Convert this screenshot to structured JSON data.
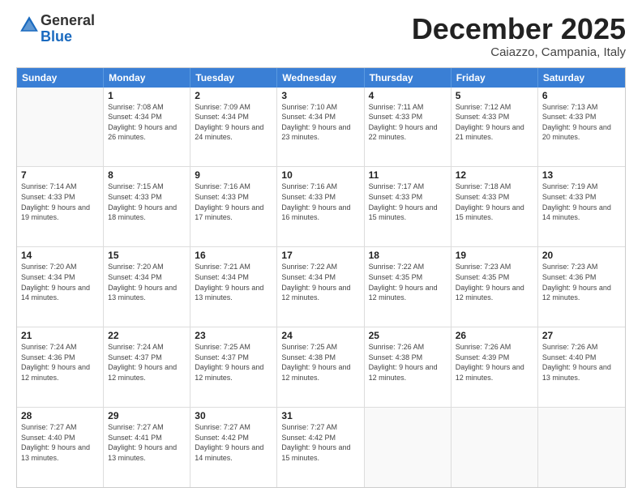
{
  "logo": {
    "line1": "General",
    "line2": "Blue"
  },
  "title": "December 2025",
  "location": "Caiazzo, Campania, Italy",
  "headers": [
    "Sunday",
    "Monday",
    "Tuesday",
    "Wednesday",
    "Thursday",
    "Friday",
    "Saturday"
  ],
  "rows": [
    [
      {
        "day": "",
        "sunrise": "",
        "sunset": "",
        "daylight": ""
      },
      {
        "day": "1",
        "sunrise": "Sunrise: 7:08 AM",
        "sunset": "Sunset: 4:34 PM",
        "daylight": "Daylight: 9 hours and 26 minutes."
      },
      {
        "day": "2",
        "sunrise": "Sunrise: 7:09 AM",
        "sunset": "Sunset: 4:34 PM",
        "daylight": "Daylight: 9 hours and 24 minutes."
      },
      {
        "day": "3",
        "sunrise": "Sunrise: 7:10 AM",
        "sunset": "Sunset: 4:34 PM",
        "daylight": "Daylight: 9 hours and 23 minutes."
      },
      {
        "day": "4",
        "sunrise": "Sunrise: 7:11 AM",
        "sunset": "Sunset: 4:33 PM",
        "daylight": "Daylight: 9 hours and 22 minutes."
      },
      {
        "day": "5",
        "sunrise": "Sunrise: 7:12 AM",
        "sunset": "Sunset: 4:33 PM",
        "daylight": "Daylight: 9 hours and 21 minutes."
      },
      {
        "day": "6",
        "sunrise": "Sunrise: 7:13 AM",
        "sunset": "Sunset: 4:33 PM",
        "daylight": "Daylight: 9 hours and 20 minutes."
      }
    ],
    [
      {
        "day": "7",
        "sunrise": "Sunrise: 7:14 AM",
        "sunset": "Sunset: 4:33 PM",
        "daylight": "Daylight: 9 hours and 19 minutes."
      },
      {
        "day": "8",
        "sunrise": "Sunrise: 7:15 AM",
        "sunset": "Sunset: 4:33 PM",
        "daylight": "Daylight: 9 hours and 18 minutes."
      },
      {
        "day": "9",
        "sunrise": "Sunrise: 7:16 AM",
        "sunset": "Sunset: 4:33 PM",
        "daylight": "Daylight: 9 hours and 17 minutes."
      },
      {
        "day": "10",
        "sunrise": "Sunrise: 7:16 AM",
        "sunset": "Sunset: 4:33 PM",
        "daylight": "Daylight: 9 hours and 16 minutes."
      },
      {
        "day": "11",
        "sunrise": "Sunrise: 7:17 AM",
        "sunset": "Sunset: 4:33 PM",
        "daylight": "Daylight: 9 hours and 15 minutes."
      },
      {
        "day": "12",
        "sunrise": "Sunrise: 7:18 AM",
        "sunset": "Sunset: 4:33 PM",
        "daylight": "Daylight: 9 hours and 15 minutes."
      },
      {
        "day": "13",
        "sunrise": "Sunrise: 7:19 AM",
        "sunset": "Sunset: 4:33 PM",
        "daylight": "Daylight: 9 hours and 14 minutes."
      }
    ],
    [
      {
        "day": "14",
        "sunrise": "Sunrise: 7:20 AM",
        "sunset": "Sunset: 4:34 PM",
        "daylight": "Daylight: 9 hours and 14 minutes."
      },
      {
        "day": "15",
        "sunrise": "Sunrise: 7:20 AM",
        "sunset": "Sunset: 4:34 PM",
        "daylight": "Daylight: 9 hours and 13 minutes."
      },
      {
        "day": "16",
        "sunrise": "Sunrise: 7:21 AM",
        "sunset": "Sunset: 4:34 PM",
        "daylight": "Daylight: 9 hours and 13 minutes."
      },
      {
        "day": "17",
        "sunrise": "Sunrise: 7:22 AM",
        "sunset": "Sunset: 4:34 PM",
        "daylight": "Daylight: 9 hours and 12 minutes."
      },
      {
        "day": "18",
        "sunrise": "Sunrise: 7:22 AM",
        "sunset": "Sunset: 4:35 PM",
        "daylight": "Daylight: 9 hours and 12 minutes."
      },
      {
        "day": "19",
        "sunrise": "Sunrise: 7:23 AM",
        "sunset": "Sunset: 4:35 PM",
        "daylight": "Daylight: 9 hours and 12 minutes."
      },
      {
        "day": "20",
        "sunrise": "Sunrise: 7:23 AM",
        "sunset": "Sunset: 4:36 PM",
        "daylight": "Daylight: 9 hours and 12 minutes."
      }
    ],
    [
      {
        "day": "21",
        "sunrise": "Sunrise: 7:24 AM",
        "sunset": "Sunset: 4:36 PM",
        "daylight": "Daylight: 9 hours and 12 minutes."
      },
      {
        "day": "22",
        "sunrise": "Sunrise: 7:24 AM",
        "sunset": "Sunset: 4:37 PM",
        "daylight": "Daylight: 9 hours and 12 minutes."
      },
      {
        "day": "23",
        "sunrise": "Sunrise: 7:25 AM",
        "sunset": "Sunset: 4:37 PM",
        "daylight": "Daylight: 9 hours and 12 minutes."
      },
      {
        "day": "24",
        "sunrise": "Sunrise: 7:25 AM",
        "sunset": "Sunset: 4:38 PM",
        "daylight": "Daylight: 9 hours and 12 minutes."
      },
      {
        "day": "25",
        "sunrise": "Sunrise: 7:26 AM",
        "sunset": "Sunset: 4:38 PM",
        "daylight": "Daylight: 9 hours and 12 minutes."
      },
      {
        "day": "26",
        "sunrise": "Sunrise: 7:26 AM",
        "sunset": "Sunset: 4:39 PM",
        "daylight": "Daylight: 9 hours and 12 minutes."
      },
      {
        "day": "27",
        "sunrise": "Sunrise: 7:26 AM",
        "sunset": "Sunset: 4:40 PM",
        "daylight": "Daylight: 9 hours and 13 minutes."
      }
    ],
    [
      {
        "day": "28",
        "sunrise": "Sunrise: 7:27 AM",
        "sunset": "Sunset: 4:40 PM",
        "daylight": "Daylight: 9 hours and 13 minutes."
      },
      {
        "day": "29",
        "sunrise": "Sunrise: 7:27 AM",
        "sunset": "Sunset: 4:41 PM",
        "daylight": "Daylight: 9 hours and 13 minutes."
      },
      {
        "day": "30",
        "sunrise": "Sunrise: 7:27 AM",
        "sunset": "Sunset: 4:42 PM",
        "daylight": "Daylight: 9 hours and 14 minutes."
      },
      {
        "day": "31",
        "sunrise": "Sunrise: 7:27 AM",
        "sunset": "Sunset: 4:42 PM",
        "daylight": "Daylight: 9 hours and 15 minutes."
      },
      {
        "day": "",
        "sunrise": "",
        "sunset": "",
        "daylight": ""
      },
      {
        "day": "",
        "sunrise": "",
        "sunset": "",
        "daylight": ""
      },
      {
        "day": "",
        "sunrise": "",
        "sunset": "",
        "daylight": ""
      }
    ]
  ]
}
